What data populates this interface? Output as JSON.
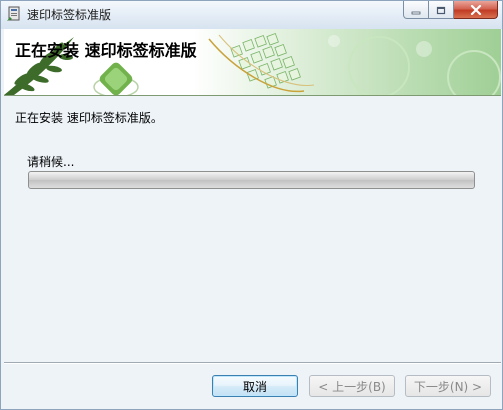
{
  "window": {
    "title": "速印标签标准版",
    "icon": "installer-icon",
    "controls": [
      "minimize-icon",
      "maximize-icon",
      "close-icon"
    ]
  },
  "banner": {
    "title": "正在安装 速印标签标准版"
  },
  "content": {
    "install_message": "正在安装 速印标签标准版。",
    "wait_label": "请稍候...",
    "progress": 0
  },
  "footer": {
    "cancel_label": "取消",
    "back_label": "< 上一步(B)",
    "next_label": "下一步(N) >"
  },
  "colors": {
    "accent_green": "#7cb86a",
    "window_bg": "#eef3f8",
    "close_red": "#c13b25"
  }
}
